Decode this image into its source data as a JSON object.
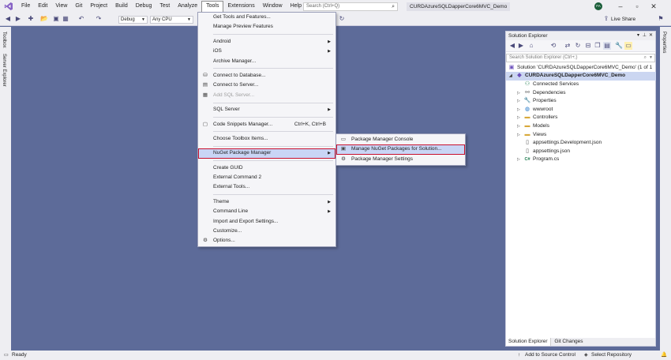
{
  "menubar": {
    "items": [
      "File",
      "Edit",
      "View",
      "Git",
      "Project",
      "Build",
      "Debug",
      "Test",
      "Analyze",
      "Tools",
      "Extensions",
      "Window",
      "Help"
    ],
    "search_placeholder": "Search (Ctrl+Q)",
    "solution_title": "CURDAzureSQLDapperCore6MVC_Demo",
    "avatar": "FA"
  },
  "toolbar": {
    "config": "Debug",
    "platform": "Any CPU",
    "live_share": "Live Share"
  },
  "side_tabs": {
    "left": [
      "Toolbox",
      "Server Explorer"
    ],
    "right": [
      "Properties"
    ]
  },
  "tools_menu": {
    "items": [
      {
        "label": "Get Tools and Features...",
        "icon": "",
        "shortcut": "",
        "sub": false,
        "disabled": false
      },
      {
        "label": "Manage Preview Features",
        "icon": "",
        "shortcut": "",
        "sub": false,
        "disabled": false
      },
      {
        "sep": true
      },
      {
        "label": "Android",
        "icon": "",
        "shortcut": "",
        "sub": true,
        "disabled": false
      },
      {
        "label": "iOS",
        "icon": "",
        "shortcut": "",
        "sub": true,
        "disabled": false
      },
      {
        "label": "Archive Manager...",
        "icon": "",
        "shortcut": "",
        "sub": false,
        "disabled": false
      },
      {
        "sep": true
      },
      {
        "label": "Connect to Database...",
        "icon": "database-icon",
        "shortcut": "",
        "sub": false,
        "disabled": false
      },
      {
        "label": "Connect to Server...",
        "icon": "server-icon",
        "shortcut": "",
        "sub": false,
        "disabled": false
      },
      {
        "label": "Add SQL Server...",
        "icon": "sql-icon",
        "shortcut": "",
        "sub": false,
        "disabled": true
      },
      {
        "sep": true
      },
      {
        "label": "SQL Server",
        "icon": "",
        "shortcut": "",
        "sub": true,
        "disabled": false
      },
      {
        "sep": true
      },
      {
        "label": "Code Snippets Manager...",
        "icon": "snippet-icon",
        "shortcut": "Ctrl+K, Ctrl+B",
        "sub": false,
        "disabled": false
      },
      {
        "sep": true
      },
      {
        "label": "Choose Toolbox Items...",
        "icon": "",
        "shortcut": "",
        "sub": false,
        "disabled": false
      },
      {
        "sep": true
      },
      {
        "label": "NuGet Package Manager",
        "icon": "",
        "shortcut": "",
        "sub": true,
        "disabled": false,
        "highlighted": true
      },
      {
        "sep": true
      },
      {
        "label": "Create GUID",
        "icon": "",
        "shortcut": "",
        "sub": false,
        "disabled": false
      },
      {
        "label": "External Command 2",
        "icon": "",
        "shortcut": "",
        "sub": false,
        "disabled": false
      },
      {
        "label": "External Tools...",
        "icon": "",
        "shortcut": "",
        "sub": false,
        "disabled": false
      },
      {
        "sep": true
      },
      {
        "label": "Theme",
        "icon": "",
        "shortcut": "",
        "sub": true,
        "disabled": false
      },
      {
        "label": "Command Line",
        "icon": "",
        "shortcut": "",
        "sub": true,
        "disabled": false
      },
      {
        "label": "Import and Export Settings...",
        "icon": "",
        "shortcut": "",
        "sub": false,
        "disabled": false
      },
      {
        "label": "Customize...",
        "icon": "",
        "shortcut": "",
        "sub": false,
        "disabled": false
      },
      {
        "label": "Options...",
        "icon": "gear-icon",
        "shortcut": "",
        "sub": false,
        "disabled": false
      }
    ]
  },
  "nuget_menu": {
    "items": [
      {
        "label": "Package Manager Console",
        "icon": "console-icon",
        "highlighted": false
      },
      {
        "label": "Manage NuGet Packages for Solution...",
        "icon": "package-icon",
        "highlighted": true
      },
      {
        "label": "Package Manager Settings",
        "icon": "gear-icon",
        "highlighted": false
      }
    ]
  },
  "solution_explorer": {
    "title": "Solution Explorer",
    "search_placeholder": "Search Solution Explorer (Ctrl+;)",
    "solution_label": "Solution 'CURDAzureSQLDapperCore6MVC_Demo' (1 of 1",
    "project_label": "CURDAzureSQLDapperCore6MVC_Demo",
    "nodes": [
      {
        "label": "Connected Services",
        "icon": "connected-services-icon",
        "expandable": false
      },
      {
        "label": "Dependencies",
        "icon": "dependencies-icon",
        "expandable": true
      },
      {
        "label": "Properties",
        "icon": "properties-icon",
        "expandable": true
      },
      {
        "label": "wwwroot",
        "icon": "globe-icon",
        "expandable": true
      },
      {
        "label": "Controllers",
        "icon": "folder-icon",
        "expandable": true
      },
      {
        "label": "Models",
        "icon": "folder-icon",
        "expandable": true
      },
      {
        "label": "Views",
        "icon": "folder-icon",
        "expandable": true
      },
      {
        "label": "appsettings.Development.json",
        "icon": "json-file-icon",
        "expandable": false
      },
      {
        "label": "appsettings.json",
        "icon": "json-file-icon",
        "expandable": false
      },
      {
        "label": "Program.cs",
        "icon": "csharp-file-icon",
        "expandable": true
      }
    ],
    "tabs": [
      "Solution Explorer",
      "Git Changes"
    ]
  },
  "statusbar": {
    "ready": "Ready",
    "add_source": "Add to Source Control",
    "select_repo": "Select Repository"
  }
}
